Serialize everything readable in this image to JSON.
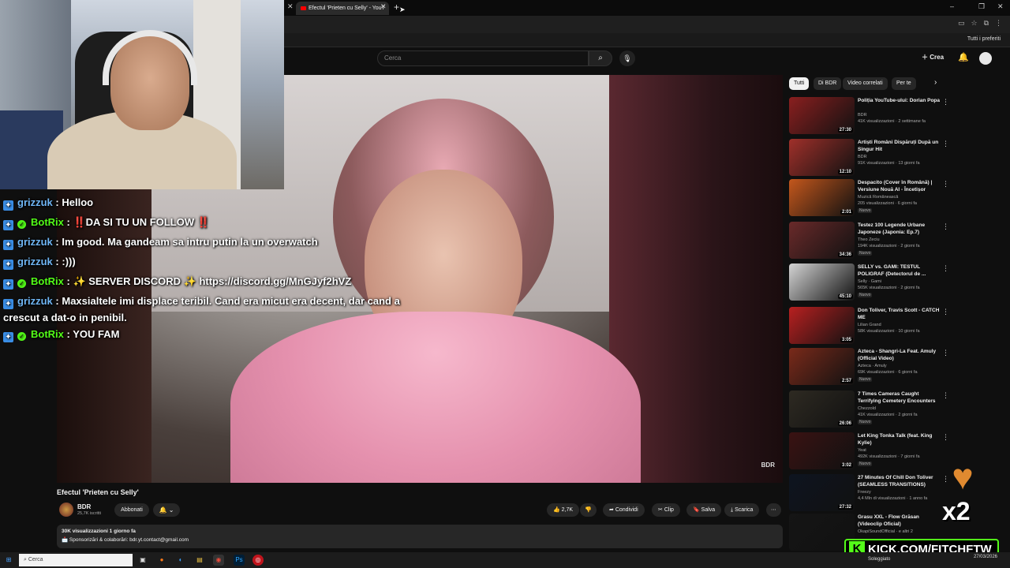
{
  "browser": {
    "tab_title": "Efectul 'Prieten cu Selly' - YouT",
    "bookmarks_label": "Tutti i preferiti"
  },
  "yt_header": {
    "search_placeholder": "Cerca",
    "create_label": "Crea"
  },
  "chat": [
    {
      "user": "grizzuk",
      "color": "blue",
      "bot": false,
      "message": "Helloo"
    },
    {
      "user": "BotRix",
      "color": "green",
      "bot": true,
      "message": "‼️DA SI TU UN FOLLOW ‼️"
    },
    {
      "user": "grizzuk",
      "color": "blue",
      "bot": false,
      "message": "Im good. Ma gandeam sa intru putin la un overwatch"
    },
    {
      "user": "grizzuk",
      "color": "blue",
      "bot": false,
      "message": ":)))"
    },
    {
      "user": "BotRix",
      "color": "green",
      "bot": true,
      "message": "✨ SERVER DISCORD ✨ https://discord.gg/MnGJyf2hVZ"
    },
    {
      "user": "grizzuk",
      "color": "blue",
      "bot": false,
      "message": "Maxsialtele imi displace teribil. Cand era micut era decent, dar cand a crescut a dat-o in penibil."
    },
    {
      "user": "BotRix",
      "color": "green",
      "bot": true,
      "message": "YOU FAM"
    }
  ],
  "video": {
    "watermark": "BDR",
    "title": "Efectul 'Prieten cu Selly'",
    "channel": "BDR",
    "subscribers": "25,7K iscritti",
    "subscribe_label": "Abbonati",
    "likes": "2,7K",
    "share_label": "Condividi",
    "clip_label": "Clip",
    "save_label": "Salva",
    "download_label": "Scarica",
    "stats": "30K visualizzazioni  1 giorno fa",
    "description": "📩 Sponsorizări & colaborări: bdr.yt.contact@gmail.com"
  },
  "chips": [
    {
      "label": "Tutti",
      "active": true
    },
    {
      "label": "Di BDR",
      "active": false
    },
    {
      "label": "Video correlati",
      "active": false
    },
    {
      "label": "Per te",
      "active": false
    }
  ],
  "recommendations": [
    {
      "title": "Poliția YouTube-ului: Dorian Popa",
      "channel": "BDR",
      "meta": "41K visualizzazioni · 2 settimane fa",
      "badge": "",
      "duration": "27:30",
      "thumb": "#8a1f1f"
    },
    {
      "title": "Artiști Români Dispăruți După un Singur Hit",
      "channel": "BDR",
      "meta": "91K visualizzazioni · 13 giorni fa",
      "badge": "",
      "duration": "12:10",
      "thumb": "#a0302a"
    },
    {
      "title": "Despacito (Cover în Română) | Versiune Nouă AI - Încetișor",
      "channel": "Muzică Românească",
      "meta": "205 visualizzazioni · 6 giorni fa",
      "badge": "Nuovo",
      "duration": "2:01",
      "thumb": "#c4571c"
    },
    {
      "title": "Testez 100 Legende Urbane Japoneze (Japonia: Ep.7)",
      "channel": "Theo Zeciu",
      "meta": "194K visualizzazioni · 2 giorni fa",
      "badge": "Nuovo",
      "duration": "34:36",
      "thumb": "#6a2a2a"
    },
    {
      "title": "SELLY vs. GAMI: TESTUL POLIGRAF (Detectorul de ...",
      "channel": "Selly · Gami",
      "meta": "565K visualizzazioni · 2 giorni fa",
      "badge": "Nuovo",
      "duration": "45:10",
      "thumb": "#d4d4d4"
    },
    {
      "title": "Don Toliver, Travis Scott - CATCH ME",
      "channel": "Lilian Grand",
      "meta": "58K visualizzazioni · 10 giorni fa",
      "badge": "",
      "duration": "3:05",
      "thumb": "#b82020"
    },
    {
      "title": "Azteca - Shangri-La Feat. Amuly (Official Video)",
      "channel": "Azteca · Amuly",
      "meta": "69K visualizzazioni · 6 giorni fa",
      "badge": "Nuovo",
      "duration": "2:57",
      "thumb": "#7a2a1a"
    },
    {
      "title": "7 Times Cameras Caught Terrifying Cemetery Encounters",
      "channel": "Chezzold",
      "meta": "41K visualizzazioni · 2 giorni fa",
      "badge": "Nuovo",
      "duration": "26:06",
      "thumb": "#2e2a22"
    },
    {
      "title": "Let King Tonka Talk (feat. King Kylie)",
      "channel": "Yeat",
      "meta": "492K visualizzazioni · 7 giorni fa",
      "badge": "Nuovo",
      "duration": "3:02",
      "thumb": "#3a1212"
    },
    {
      "title": "27 Minutes Of Chill Don Toliver (SEAMLESS TRANSITIONS)",
      "channel": "Freezy",
      "meta": "4,4 Mln di visualizzazioni · 1 anno fa",
      "badge": "",
      "duration": "27:32",
      "thumb": "#0e1420"
    },
    {
      "title": "Grasu XXL - Flow Grăsan (Videoclip Oficial)",
      "channel": "OkapiSoundOfficial · e altri 2",
      "meta": "",
      "badge": "",
      "duration": "",
      "thumb": "#151515"
    }
  ],
  "overlays": {
    "multiplier": "x2",
    "kick_letter": "K",
    "kick_url": "KICK.COM/FITCHFTW"
  },
  "taskbar": {
    "search_placeholder": "Cerca",
    "tray_text": "Soleggiato",
    "date": "27/03/2026"
  },
  "colors": {
    "background": "#0f0f0f",
    "chat_user_blue": "#6fb6f5",
    "chat_user_green": "#53fc18",
    "kick_green": "#53fc18"
  }
}
